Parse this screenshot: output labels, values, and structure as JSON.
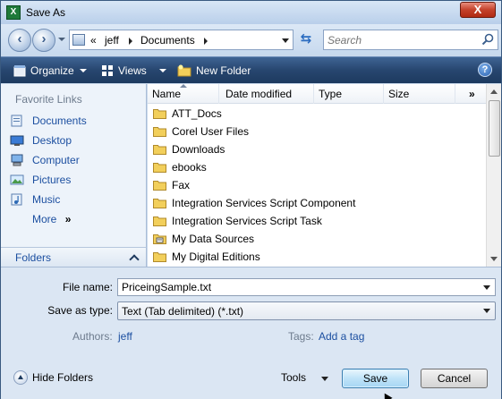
{
  "window": {
    "title": "Save As",
    "close_label": "X",
    "app_icon_letter": "X"
  },
  "address": {
    "path": [
      "«",
      "jeff",
      "Documents"
    ],
    "search_placeholder": "Search"
  },
  "toolbar": {
    "organize": "Organize",
    "views": "Views",
    "new_folder": "New Folder",
    "help": "?"
  },
  "sidebar": {
    "title": "Favorite Links",
    "items": [
      {
        "label": "Documents",
        "icon": "documents-icon"
      },
      {
        "label": "Desktop",
        "icon": "desktop-icon"
      },
      {
        "label": "Computer",
        "icon": "computer-icon"
      },
      {
        "label": "Pictures",
        "icon": "pictures-icon"
      },
      {
        "label": "Music",
        "icon": "music-icon"
      },
      {
        "label": "More",
        "icon": "double-chevron-icon"
      }
    ],
    "more_glyph": "»",
    "folders_label": "Folders"
  },
  "file_list": {
    "columns": [
      "Name",
      "Date modified",
      "Type",
      "Size"
    ],
    "more_columns": "»",
    "items": [
      {
        "name": "ATT_Docs",
        "icon": "folder-icon"
      },
      {
        "name": "Corel User Files",
        "icon": "folder-icon"
      },
      {
        "name": "Downloads",
        "icon": "folder-icon"
      },
      {
        "name": "ebooks",
        "icon": "folder-icon"
      },
      {
        "name": "Fax",
        "icon": "folder-icon"
      },
      {
        "name": "Integration Services Script Component",
        "icon": "folder-icon"
      },
      {
        "name": "Integration Services Script Task",
        "icon": "folder-icon"
      },
      {
        "name": "My Data Sources",
        "icon": "data-sources-folder-icon"
      },
      {
        "name": "My Digital Editions",
        "icon": "folder-icon"
      }
    ]
  },
  "form": {
    "file_name_label": "File name:",
    "file_name_value": "PriceingSample.txt",
    "save_type_label": "Save as type:",
    "save_type_value": "Text (Tab delimited) (*.txt)",
    "authors_label": "Authors:",
    "authors_value": "jeff",
    "tags_label": "Tags:",
    "tags_value": "Add a tag"
  },
  "footer": {
    "hide_folders": "Hide Folders",
    "tools": "Tools",
    "save": "Save",
    "cancel": "Cancel"
  },
  "colors": {
    "toolbar_bg": "#27466f",
    "link": "#1c4fa0",
    "save_button": "#bfe3f8"
  }
}
